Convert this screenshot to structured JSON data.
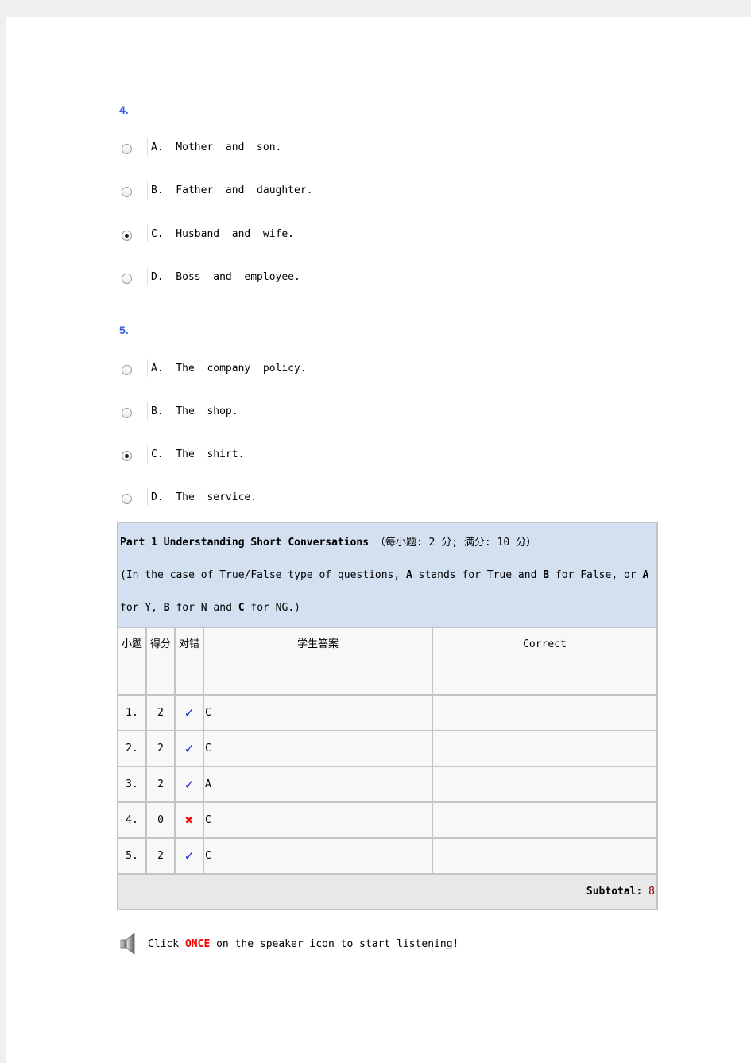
{
  "questions": [
    {
      "number": "4.",
      "options": [
        {
          "label": "A.  Mother  and  son.",
          "selected": false
        },
        {
          "label": "B.  Father  and  daughter.",
          "selected": false
        },
        {
          "label": "C.  Husband  and  wife.",
          "selected": true
        },
        {
          "label": "D.  Boss  and  employee.",
          "selected": false
        }
      ]
    },
    {
      "number": "5.",
      "options": [
        {
          "label": "A.  The  company  policy.",
          "selected": false
        },
        {
          "label": "B.  The  shop.",
          "selected": false
        },
        {
          "label": "C.  The  shirt.",
          "selected": true
        },
        {
          "label": "D.  The  service.",
          "selected": false
        }
      ]
    }
  ],
  "results": {
    "title": "Part 1 Understanding Short Conversations",
    "scoring": "（每小题: 2 分; 满分: 10 分）",
    "note_pre": "(In the case of True/False type of questions, ",
    "note_a": "A",
    "note_mid1": " stands for True and ",
    "note_b": "B",
    "note_mid2": " for False, or ",
    "note_a2": "A",
    "note_mid3": " for Y, ",
    "note_b2": "B",
    "note_mid4": " for N and ",
    "note_c": "C",
    "note_end": " for NG.)",
    "columns": [
      "小题",
      "得分",
      "对错",
      "学生答案",
      "Correct"
    ],
    "rows": [
      {
        "no": "1.",
        "score": "2",
        "result": "correct",
        "answer": "C",
        "correct": ""
      },
      {
        "no": "2.",
        "score": "2",
        "result": "correct",
        "answer": "C",
        "correct": ""
      },
      {
        "no": "3.",
        "score": "2",
        "result": "correct",
        "answer": "A",
        "correct": ""
      },
      {
        "no": "4.",
        "score": "0",
        "result": "wrong",
        "answer": "C",
        "correct": ""
      },
      {
        "no": "5.",
        "score": "2",
        "result": "correct",
        "answer": "C",
        "correct": ""
      }
    ],
    "subtotal_label": "Subtotal:",
    "subtotal_value": "8"
  },
  "footer": {
    "pre": "Click ",
    "emph": "ONCE",
    "post": " on the speaker icon to start listening!",
    "icon": "speaker-icon"
  },
  "colors": {
    "question_number": "#3b5fd6",
    "header_bg": "#d2e0ef",
    "check": "#1c2fd8",
    "cross": "#ff0000",
    "emphasis": "#ff0000"
  }
}
